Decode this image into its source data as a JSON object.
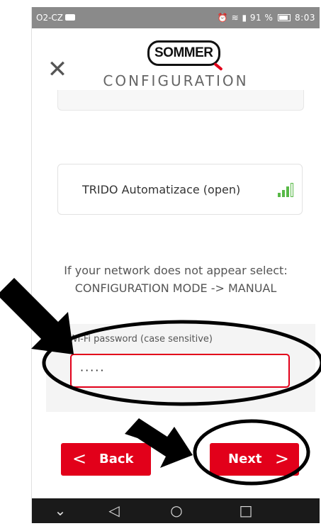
{
  "status_bar": {
    "carrier": "O2-CZ",
    "battery_text": "91 %",
    "time": "8:03"
  },
  "header": {
    "close_icon": "close-icon",
    "logo_text": "SOMMER",
    "title": "CONFIGURATION"
  },
  "network": {
    "name": "TRIDO Automatizace (open)",
    "signal_icon": "wifi-signal-icon"
  },
  "hint": {
    "line1": "If your network does not appear select:",
    "line2": "CONFIGURATION MODE -> MANUAL"
  },
  "password": {
    "label": "Wi-Fi password (case sensitive)",
    "value": "·····"
  },
  "buttons": {
    "back_label": "Back",
    "next_label": "Next",
    "back_chevron": "<",
    "next_chevron": ">"
  },
  "nav": {
    "down": "⌄",
    "back": "◁",
    "home": "○",
    "recents": "□"
  },
  "colors": {
    "accent": "#e2001a",
    "status_bar": "#8a8a8a",
    "nav_bar": "#1a1a1a",
    "signal_green": "#58b947"
  }
}
